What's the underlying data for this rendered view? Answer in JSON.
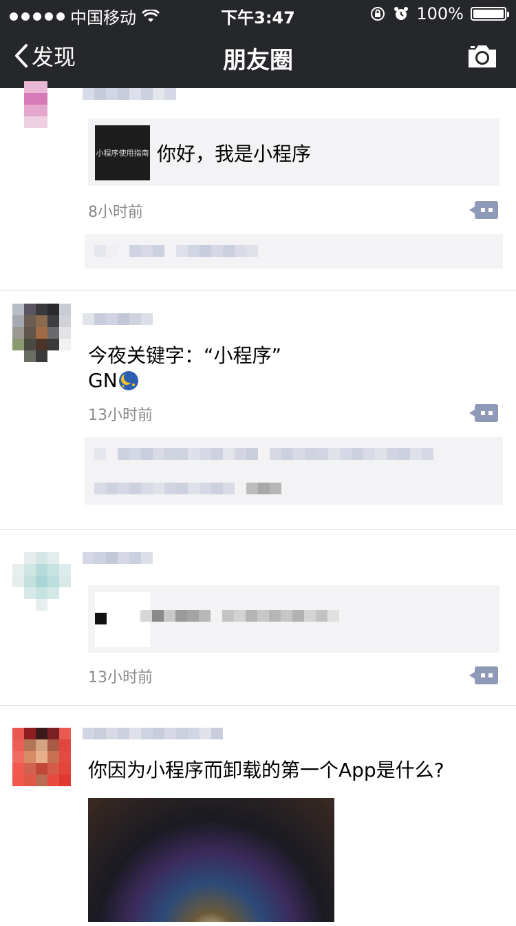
{
  "status_bar": {
    "carrier": "中国移动",
    "time": "下午3:47",
    "battery": "100%",
    "battery_level": 1.0
  },
  "nav": {
    "back_label": "发现",
    "title": "朋友圈"
  },
  "posts": [
    {
      "card_text": "你好，我是小程序",
      "thumb_text": "小程序使用指南",
      "time": "8小时前"
    },
    {
      "text_line1": "今夜关键字：“小程序”",
      "text_line2": "GN",
      "time": "13小时前"
    },
    {
      "time": "13小时前"
    },
    {
      "text": "你因为小程序而卸载的第一个App是什么?"
    }
  ]
}
